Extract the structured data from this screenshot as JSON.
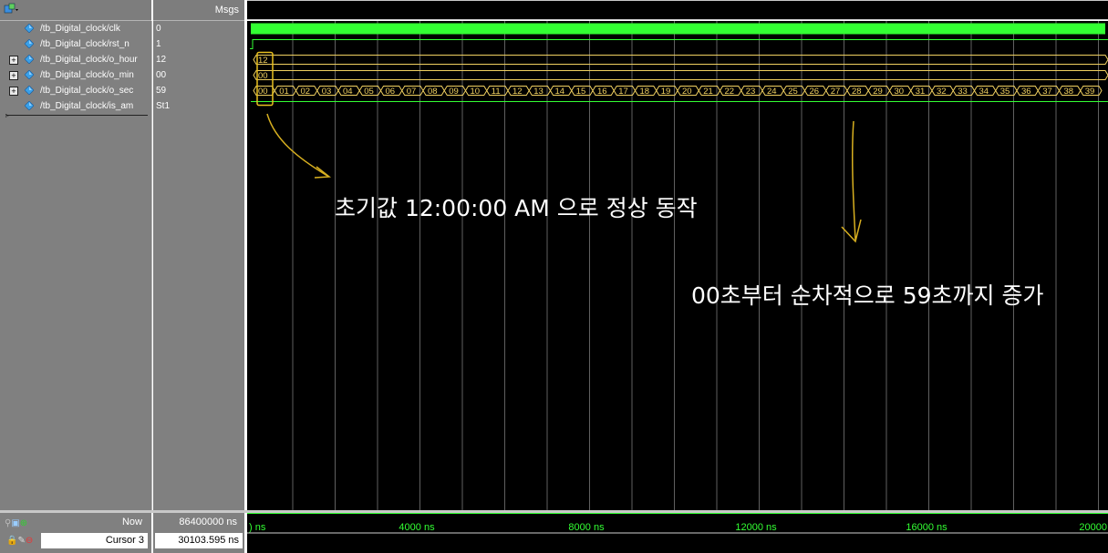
{
  "header": {
    "values_title": "Msgs"
  },
  "signals": [
    {
      "name": "/tb_Digital_clock/clk",
      "value": "0",
      "expandable": false
    },
    {
      "name": "/tb_Digital_clock/rst_n",
      "value": "1",
      "expandable": false
    },
    {
      "name": "/tb_Digital_clock/o_hour",
      "value": "12",
      "expandable": true
    },
    {
      "name": "/tb_Digital_clock/o_min",
      "value": "00",
      "expandable": true
    },
    {
      "name": "/tb_Digital_clock/o_sec",
      "value": "59",
      "expandable": true
    },
    {
      "name": "/tb_Digital_clock/is_am",
      "value": "St1",
      "expandable": false
    }
  ],
  "wave": {
    "hour_value": "12",
    "min_value": "00",
    "sec_values": [
      "00",
      "01",
      "02",
      "03",
      "04",
      "05",
      "06",
      "07",
      "08",
      "09",
      "10",
      "11",
      "12",
      "13",
      "14",
      "15",
      "16",
      "17",
      "18",
      "19",
      "20",
      "21",
      "22",
      "23",
      "24",
      "25",
      "26",
      "27",
      "28",
      "29",
      "30",
      "31",
      "32",
      "33",
      "34",
      "35",
      "36",
      "37",
      "38",
      "39"
    ],
    "colors": {
      "clk": "#33ff33",
      "bus": "#f0d060",
      "grid": "#ffffff",
      "timeline": "#33ff33"
    }
  },
  "annotations": {
    "note1": "초기값 12:00:00 AM 으로 정상 동작",
    "note2": "00초부터 순차적으로 59초까지 증가"
  },
  "status": {
    "now_label": "Now",
    "now_value": "86400000 ns",
    "cursor_label": "Cursor 3",
    "cursor_value": "30103.595 ns"
  },
  "timeline": {
    "ticks": [
      ") ns",
      "4000 ns",
      "8000 ns",
      "12000 ns",
      "16000 ns",
      "20000"
    ]
  }
}
